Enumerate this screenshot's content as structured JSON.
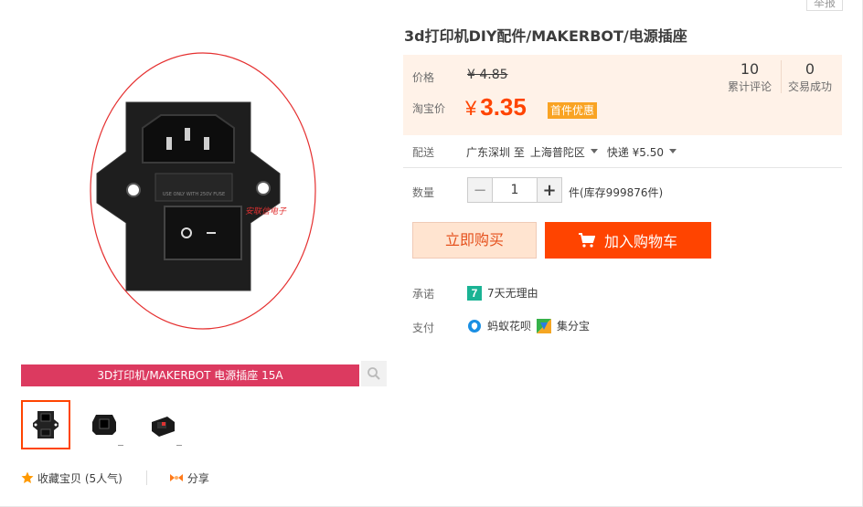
{
  "header": {
    "report_label": "举报"
  },
  "product": {
    "title": "3d打印机DIY配件/MAKERBOT/电源插座",
    "caption": "3D打印机/MAKERBOT 电源插座 15A",
    "image_watermark": "安联信电子"
  },
  "price": {
    "original_label": "价格",
    "original_value": "¥ 4.85",
    "promo_label": "淘宝价",
    "promo_currency": "¥",
    "promo_value": "3.35",
    "promo_badge": "首件优惠"
  },
  "stats": {
    "reviews_count": "10",
    "reviews_label": "累计评论",
    "sales_count": "0",
    "sales_label": "交易成功"
  },
  "shipping": {
    "label": "配送",
    "from": "广东深圳 至",
    "to": "上海普陀区",
    "method": "快递 ¥5.50"
  },
  "quantity": {
    "label": "数量",
    "minus": "−",
    "value": "1",
    "plus": "+",
    "stock_text": "件(库存999876件)"
  },
  "actions": {
    "buy_now": "立即购买",
    "add_to_cart": "加入购物车"
  },
  "promise": {
    "label": "承诺",
    "icon_text": "7",
    "text": "7天无理由"
  },
  "payment": {
    "label": "支付",
    "methods": [
      "蚂蚁花呗",
      "集分宝"
    ]
  },
  "social": {
    "favorite": "收藏宝贝 (5人气)",
    "share": "分享"
  },
  "colors": {
    "accent": "#ff4400",
    "caption_bar": "#dc3a60",
    "price_bg": "#fff2e8",
    "badge": "#f9a323"
  }
}
